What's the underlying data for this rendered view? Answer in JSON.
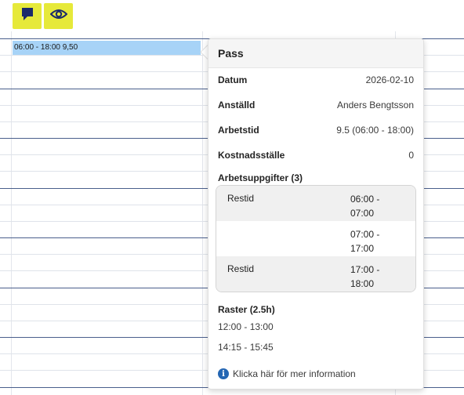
{
  "toolbar": {
    "comment_icon": "comment-icon",
    "view_icon": "eye-icon",
    "button_color": "#e6e93a"
  },
  "schedule": {
    "shift_bar_label": "06:00 - 18:00 9,50",
    "shift_bar_color": "#a7d3f7"
  },
  "popup": {
    "title": "Pass",
    "fields": [
      {
        "label": "Datum",
        "value": "2026-02-10"
      },
      {
        "label": "Anställd",
        "value": "Anders Bengtsson"
      },
      {
        "label": "Arbetstid",
        "value": "9.5 (06:00 - 18:00)"
      },
      {
        "label": "Kostnadsställe",
        "value": "0"
      }
    ],
    "tasks_title": "Arbetsuppgifter (3)",
    "tasks": [
      {
        "name": "Restid",
        "start": "06:00 -",
        "end": "07:00"
      },
      {
        "name": "",
        "start": "07:00 -",
        "end": "17:00"
      },
      {
        "name": "Restid",
        "start": "17:00 -",
        "end": "18:00"
      }
    ],
    "breaks_title": "Raster (2.5h)",
    "breaks": [
      "12:00 - 13:00",
      "14:15 - 15:45"
    ],
    "info_link": "Klicka här för mer information"
  }
}
